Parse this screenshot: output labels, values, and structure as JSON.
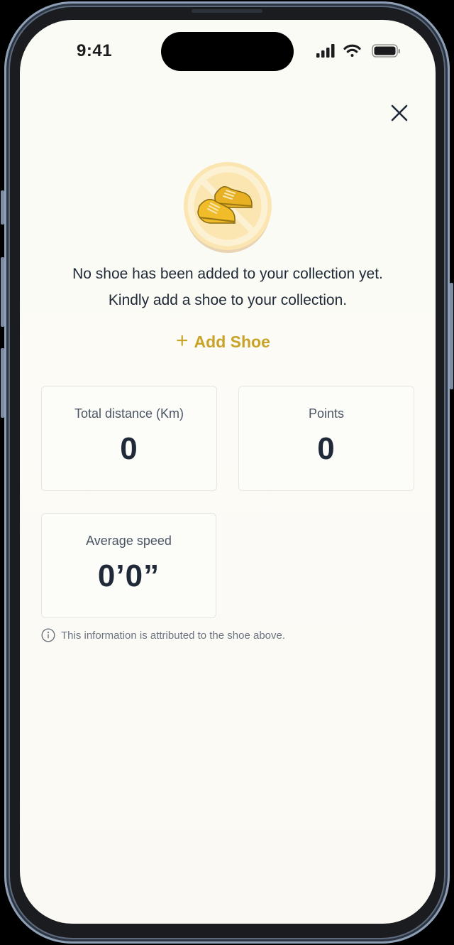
{
  "status_bar": {
    "time": "9:41"
  },
  "empty_state": {
    "icon": "no-shoe-icon",
    "line1": "No shoe has been added to your collection yet.",
    "line2": "Kindly add a shoe to your collection.",
    "add_label": "Add Shoe",
    "add_icon": "plus-icon"
  },
  "stats": {
    "total_distance": {
      "label": "Total distance (Km)",
      "value": "0"
    },
    "points": {
      "label": "Points",
      "value": "0"
    },
    "average_speed": {
      "label": "Average speed",
      "value": "0’0”"
    }
  },
  "info": {
    "icon": "info-icon",
    "text": "This information is attributed to the shoe above."
  },
  "colors": {
    "accent": "#c9a227",
    "text_dark": "#1f2937",
    "background": "#fbfbf6"
  }
}
